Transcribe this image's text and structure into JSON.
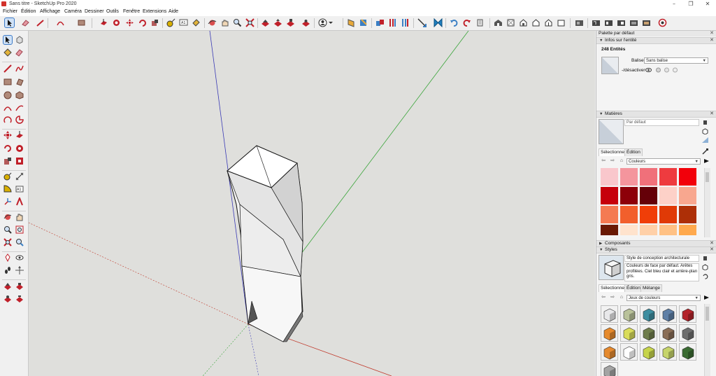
{
  "window": {
    "title": "Sans titre - SketchUp Pro 2020"
  },
  "menu": {
    "items": [
      "Fichier",
      "Édition",
      "Affichage",
      "Caméra",
      "Dessiner",
      "Outils",
      "Fenêtre",
      "Extensions",
      "Aide"
    ]
  },
  "colors": {
    "accent": "#3d7bc8",
    "viewport_bg": "#dfdfdc",
    "axis_red": "#c0392b",
    "axis_green": "#3aa53a",
    "axis_blue": "#3a3ab5"
  },
  "panel": {
    "title": "Palette par défaut",
    "entity_info": {
      "header": "Infos sur l'entité",
      "count": "248 Entités",
      "tag_label": "Balise:",
      "tag_value": "Sans balise",
      "toggle_label": "-/désactiver"
    },
    "materials": {
      "header": "Matières",
      "name_placeholder": "Par défaut",
      "tabs": [
        "Sélectionner",
        "Édition"
      ],
      "library": "Couleurs",
      "swatches": [
        "#f9c7cc",
        "#f4959d",
        "#f0707a",
        "#ee3b3f",
        "#f2000a",
        "#c6000b",
        "#8d0009",
        "#650008",
        "#fdd1c8",
        "#f8a78f",
        "#f47a52",
        "#f25f2c",
        "#f03e08",
        "#e03a06",
        "#ad2f07",
        "#6a1a05",
        "#ffe3cd",
        "#ffd0a8",
        "#ffc184",
        "#ffa94d"
      ]
    },
    "components": {
      "header": "Composants"
    },
    "styles": {
      "header": "Styles",
      "name": "Style de conception architecturale",
      "description": "Couleurs de face par défaut. Arêtes profilées. Ciel bleu clair et arrière-plan gris.",
      "tabs": [
        "Sélectionner",
        "Édition",
        "Mélange"
      ],
      "library": "Jeux de couleurs",
      "tiles": [
        "#e8e8ea",
        "#b9c29a",
        "#3e8ea0",
        "#5e7fa6",
        "#b3232a",
        "#e68a2c",
        "#d9dc5a",
        "#6f7d4c",
        "#8a6e57",
        "#6e6e6e",
        "#e58a2f",
        "#ffffff",
        "#c6d44b",
        "#c6d46a",
        "#3a6b32",
        "#a4a4a4"
      ]
    }
  }
}
